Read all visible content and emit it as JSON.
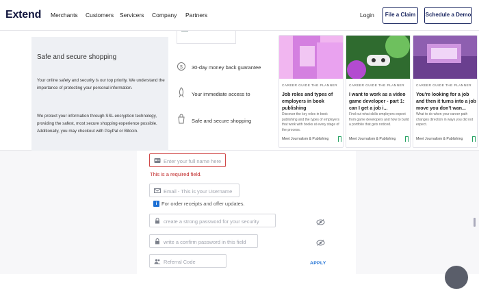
{
  "nav": {
    "logo": "Extend",
    "links": [
      "Merchants",
      "Customers",
      "Servicers",
      "Company",
      "Partners"
    ],
    "login": "Login",
    "file_claim": "File a Claim",
    "schedule_demo": "Schedule a Demo"
  },
  "safe": {
    "title": "Safe and secure shopping",
    "p1": "Your online safety and security is our top priority. We understand the importance of protecting your personal information.",
    "p2": "We protect your information through SSL encryption technology, providing the safest, most secure shopping experience possible. Additionally, you may checkout with PayPal or Bitcoin."
  },
  "features": [
    {
      "icon": "money-back-icon",
      "text": "30-day money back guarantee"
    },
    {
      "icon": "rocket-icon",
      "text": "Your immediate access to"
    },
    {
      "icon": "secure-shopping-icon",
      "text": "Safe and secure shopping"
    }
  ],
  "cards": [
    {
      "tag": "CAREER GUIDE THE PLANNER",
      "title": "Job roles and types of employers in book publishing",
      "excerpt": "Discover the key roles in book publishing and the types of employers that work with books at every stage of the process.",
      "author": "Meet Journalism & Publishing",
      "img_colors": [
        "#f1b6f0",
        "#c86ad8",
        "#e9a2ef"
      ]
    },
    {
      "tag": "CAREER GUIDE THE PLANNER",
      "title": "I want to work as a video game developer - part 1: can I get a job i...",
      "excerpt": "Find out what skills employers expect from game developers and how to build a portfolio that gets noticed.",
      "author": "Meet Journalism & Publishing",
      "img_colors": [
        "#2f6b2f",
        "#6ec05e",
        "#b34bd0"
      ]
    },
    {
      "tag": "CAREER GUIDE THE PLANNER",
      "title": "You're looking for a job and then it turns into a job move you don't wan...",
      "excerpt": "What to do when your career path changes direction in ways you did not expect.",
      "author": "Meet Journalism & Publishing",
      "img_colors": [
        "#8e5fb0",
        "#cf95e0",
        "#6a3f8f"
      ]
    }
  ],
  "form": {
    "name_placeholder": "Enter your full name here",
    "error": "This is a required field.",
    "email_placeholder": "Email - This is your Username",
    "email_hint": "For order receipts and offer updates.",
    "password_placeholder": "create a strong password for your security",
    "confirm_placeholder": "write a confirm password in this field",
    "referral_placeholder": "Referral Code",
    "apply": "APPLY",
    "info_badge": "i"
  }
}
